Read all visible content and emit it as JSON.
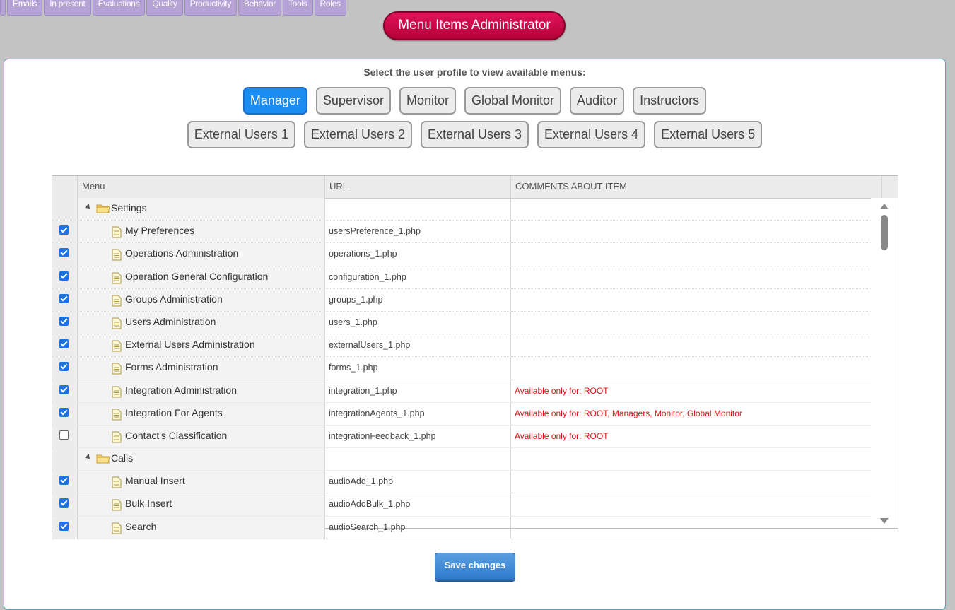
{
  "topnav": [
    "",
    "Emails",
    "In present",
    "Evaluations",
    "Quality",
    "Productivity",
    "Behavior",
    "Tools",
    "Roles"
  ],
  "title": "Menu Items Administrator",
  "prompt": "Select the user profile to view available menus:",
  "profiles_row1": [
    {
      "label": "Manager",
      "active": true
    },
    {
      "label": "Supervisor",
      "active": false
    },
    {
      "label": "Monitor",
      "active": false
    },
    {
      "label": "Global Monitor",
      "active": false
    },
    {
      "label": "Auditor",
      "active": false
    },
    {
      "label": "Instructors",
      "active": false
    }
  ],
  "profiles_row2": [
    {
      "label": "External Users 1",
      "active": false
    },
    {
      "label": "External Users 2",
      "active": false
    },
    {
      "label": "External Users 3",
      "active": false
    },
    {
      "label": "External Users 4",
      "active": false
    },
    {
      "label": "External Users 5",
      "active": false
    }
  ],
  "grid": {
    "headers": {
      "menu": "Menu",
      "url": "URL",
      "comments": "COMMENTS ABOUT ITEM"
    },
    "rows": [
      {
        "type": "folder",
        "label": "Settings"
      },
      {
        "type": "item",
        "checked": true,
        "label": "My Preferences",
        "url": "usersPreference_1.php",
        "comment": ""
      },
      {
        "type": "item",
        "checked": true,
        "label": "Operations Administration",
        "url": "operations_1.php",
        "comment": ""
      },
      {
        "type": "item",
        "checked": true,
        "label": "Operation General Configuration",
        "url": "configuration_1.php",
        "comment": ""
      },
      {
        "type": "item",
        "checked": true,
        "label": "Groups Administration",
        "url": "groups_1.php",
        "comment": ""
      },
      {
        "type": "item",
        "checked": true,
        "label": "Users Administration",
        "url": "users_1.php",
        "comment": ""
      },
      {
        "type": "item",
        "checked": true,
        "label": "External Users Administration",
        "url": "externalUsers_1.php",
        "comment": ""
      },
      {
        "type": "item",
        "checked": true,
        "label": "Forms Administration",
        "url": "forms_1.php",
        "comment": ""
      },
      {
        "type": "item",
        "checked": true,
        "label": "Integration Administration",
        "url": "integration_1.php",
        "comment": "Available only for: ROOT"
      },
      {
        "type": "item",
        "checked": true,
        "label": "Integration For Agents",
        "url": "integrationAgents_1.php",
        "comment": "Available only for: ROOT, Managers, Monitor, Global Monitor"
      },
      {
        "type": "item",
        "checked": false,
        "label": "Contact's Classification",
        "url": "integrationFeedback_1.php",
        "comment": "Available only for: ROOT"
      },
      {
        "type": "folder",
        "label": "Calls"
      },
      {
        "type": "item",
        "checked": true,
        "label": "Manual Insert",
        "url": "audioAdd_1.php",
        "comment": ""
      },
      {
        "type": "item",
        "checked": true,
        "label": "Bulk Insert",
        "url": "audioAddBulk_1.php",
        "comment": ""
      },
      {
        "type": "item",
        "checked": true,
        "label": "Search",
        "url": "audioSearch_1.php",
        "comment": ""
      }
    ]
  },
  "save_label": "Save changes",
  "colors": {
    "accent": "#1a8cf2",
    "title": "#d1094c",
    "comment": "#e01010"
  }
}
